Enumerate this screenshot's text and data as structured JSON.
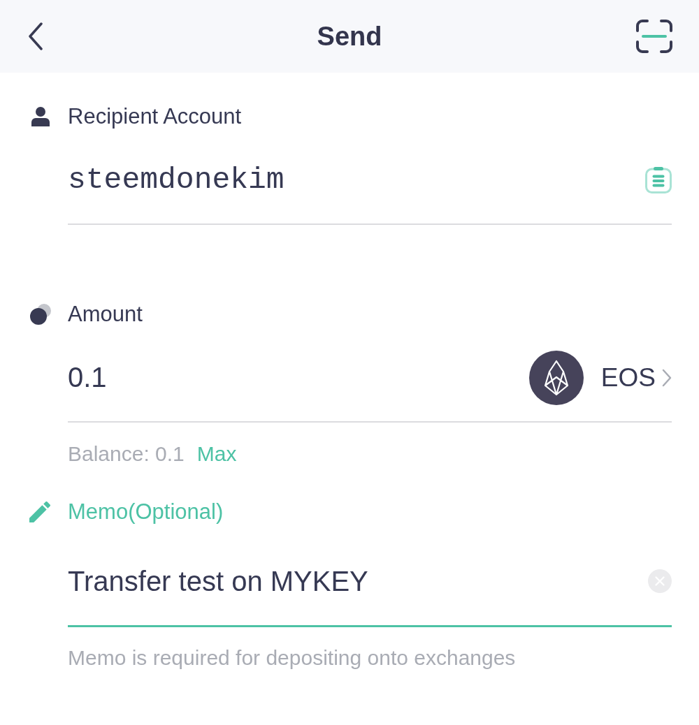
{
  "header": {
    "title": "Send"
  },
  "fields": [
    {
      "kind": "account",
      "label": "Recipient Account",
      "value": "steemdonekim",
      "focused": false
    },
    {
      "kind": "amount",
      "label": "Amount",
      "value": "0.1",
      "token": "EOS",
      "balance": "Balance: 0.1",
      "max_link": "Max",
      "focused": false
    },
    {
      "kind": "memo",
      "label": "Memo(Optional)",
      "value": "Transfer test on MYKEY",
      "hint": "Memo is required for depositing onto exchanges",
      "focused": true
    }
  ]
}
